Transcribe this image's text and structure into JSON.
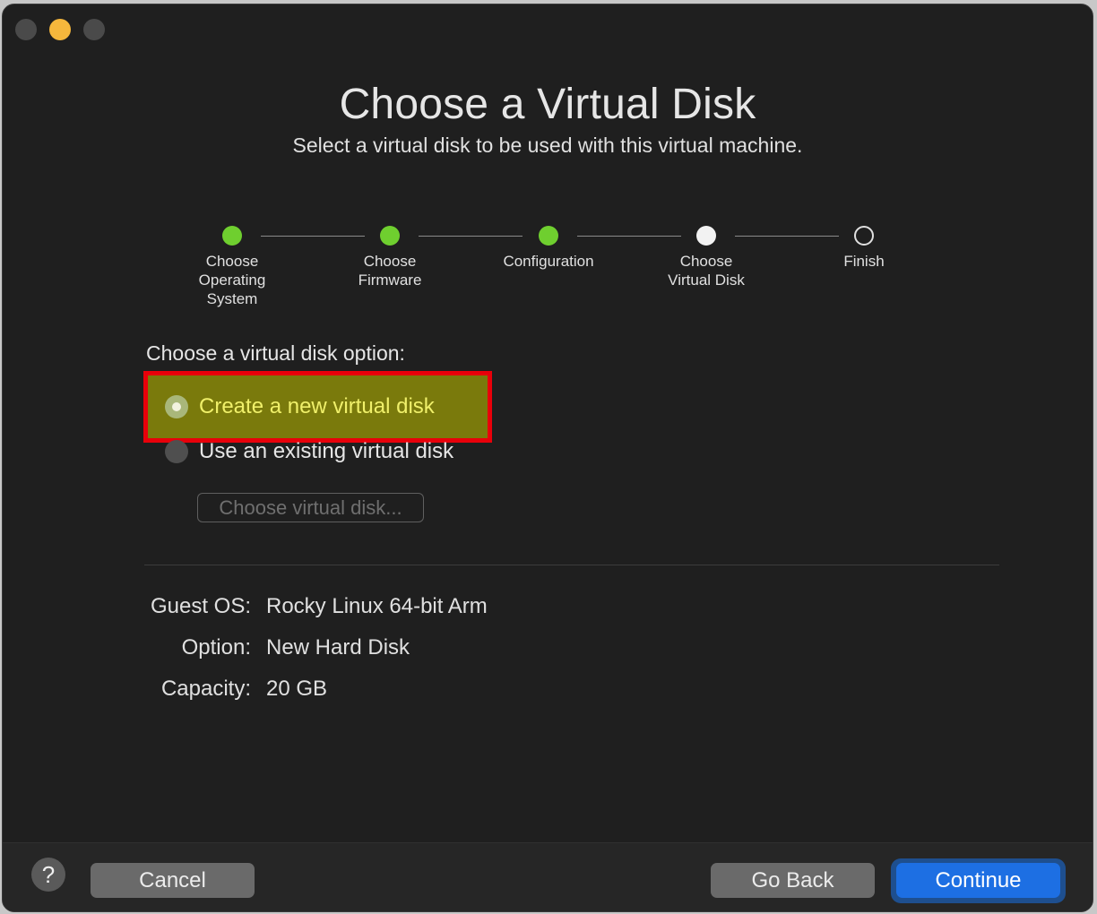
{
  "window": {
    "title": "Choose a Virtual Disk",
    "subtitle": "Select a virtual disk to be used with this virtual machine."
  },
  "steps": [
    {
      "label": "Choose\nOperating\nSystem",
      "state": "done"
    },
    {
      "label": "Choose\nFirmware",
      "state": "done"
    },
    {
      "label": "Configuration",
      "state": "done"
    },
    {
      "label": "Choose\nVirtual Disk",
      "state": "current"
    },
    {
      "label": "Finish",
      "state": "todo"
    }
  ],
  "disk_options": {
    "heading": "Choose a virtual disk option:",
    "create_new": {
      "label": "Create a new virtual disk",
      "selected": true
    },
    "use_existing": {
      "label": "Use an existing virtual disk",
      "selected": false
    },
    "choose_button": "Choose virtual disk..."
  },
  "summary": {
    "guest_os_key": "Guest OS:",
    "guest_os_value": "Rocky Linux 64-bit Arm",
    "option_key": "Option:",
    "option_value": "New Hard Disk",
    "capacity_key": "Capacity:",
    "capacity_value": "20 GB"
  },
  "footer": {
    "help": "?",
    "cancel": "Cancel",
    "go_back": "Go Back",
    "continue": "Continue"
  },
  "colors": {
    "step_done": "#6fcf2f",
    "highlight_fill": "#7a7a0c",
    "highlight_border": "#e8000a",
    "primary_button": "#1d6fe3"
  },
  "icons": [
    "close-dot-icon",
    "minimize-dot-icon",
    "maximize-dot-icon",
    "radio-selected-icon",
    "radio-unselected-icon",
    "help-icon"
  ]
}
